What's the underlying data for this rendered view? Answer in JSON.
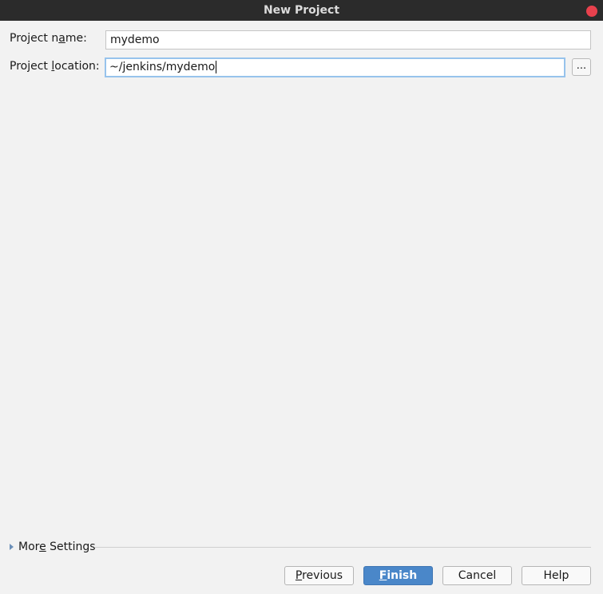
{
  "window": {
    "title": "New Project"
  },
  "form": {
    "project_name_label_pre": "Project n",
    "project_name_label_mnemonic": "a",
    "project_name_label_post": "me:",
    "project_name_value": "mydemo",
    "project_location_label_pre": "Project ",
    "project_location_label_mnemonic": "l",
    "project_location_label_post": "ocation:",
    "project_location_value": "~/jenkins/mydemo",
    "browse_label": "..."
  },
  "more_settings": {
    "label_pre": "Mor",
    "label_mnemonic": "e",
    "label_post": " Settings"
  },
  "buttons": {
    "previous_mnemonic": "P",
    "previous_rest": "revious",
    "finish_mnemonic": "F",
    "finish_rest": "inish",
    "cancel": "Cancel",
    "help": "Help"
  },
  "colors": {
    "titlebar": "#2b2b2b",
    "close": "#e8414d",
    "primary_button": "#4a87c9",
    "focus_border": "#97c3ec"
  }
}
